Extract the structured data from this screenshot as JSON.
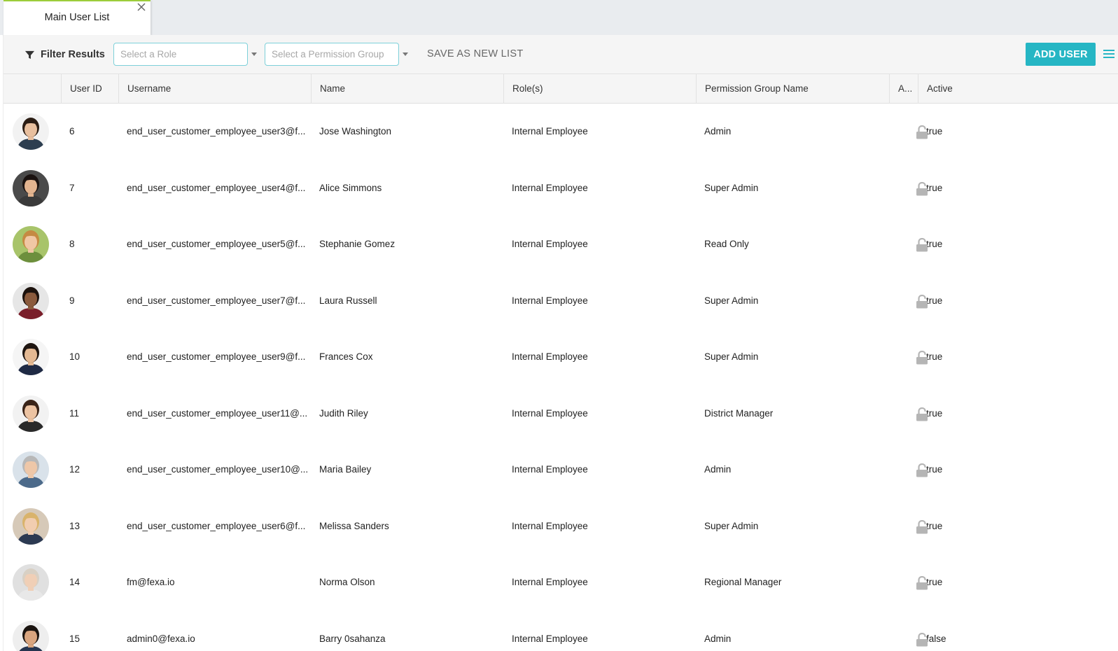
{
  "tabs": [
    {
      "label": "Main User List"
    }
  ],
  "toolbar": {
    "filter_label": "Filter Results",
    "role_placeholder": "Select a Role",
    "permission_placeholder": "Select a Permission Group",
    "save_label": "SAVE AS NEW LIST",
    "add_user_label": "ADD USER"
  },
  "colors": {
    "accent": "#26b6c4",
    "tab_indicator": "#9ccd3a",
    "select_border": "#7dd0d9"
  },
  "columns": [
    "",
    "User ID",
    "Username",
    "Name",
    "Role(s)",
    "Permission Group Name",
    "A...",
    "Active"
  ],
  "rows": [
    {
      "id": "6",
      "username": "end_user_customer_employee_user3@f...",
      "name": "Jose Washington",
      "role": "Internal Employee",
      "group": "Admin",
      "active": "true",
      "avatar": {
        "skin": "#e8bf9e",
        "hair": "#2b1d14",
        "shirt": "#2d3e50",
        "bg": "#f2f2f2"
      }
    },
    {
      "id": "7",
      "username": "end_user_customer_employee_user4@f...",
      "name": "Alice Simmons",
      "role": "Internal Employee",
      "group": "Super Admin",
      "active": "true",
      "avatar": {
        "skin": "#e3b48f",
        "hair": "#1a1210",
        "shirt": "#3a3a3a",
        "bg": "#4a4a4a"
      }
    },
    {
      "id": "8",
      "username": "end_user_customer_employee_user5@f...",
      "name": "Stephanie Gomez",
      "role": "Internal Employee",
      "group": "Read Only",
      "active": "true",
      "avatar": {
        "skin": "#f0c7a4",
        "hair": "#c58a42",
        "shirt": "#6d8f3d",
        "bg": "#a8c46a"
      }
    },
    {
      "id": "9",
      "username": "end_user_customer_employee_user7@f...",
      "name": "Laura Russell",
      "role": "Internal Employee",
      "group": "Super Admin",
      "active": "true",
      "avatar": {
        "skin": "#8a5a3c",
        "hair": "#1c120d",
        "shirt": "#7a1e2a",
        "bg": "#e6e6e6"
      }
    },
    {
      "id": "10",
      "username": "end_user_customer_employee_user9@f...",
      "name": "Frances Cox",
      "role": "Internal Employee",
      "group": "Super Admin",
      "active": "true",
      "avatar": {
        "skin": "#e4b993",
        "hair": "#1e1510",
        "shirt": "#1f2a44",
        "bg": "#f5f5f5"
      }
    },
    {
      "id": "11",
      "username": "end_user_customer_employee_user11@...",
      "name": "Judith Riley",
      "role": "Internal Employee",
      "group": "District Manager",
      "active": "true",
      "avatar": {
        "skin": "#ecc3a2",
        "hair": "#3a2418",
        "shirt": "#2a2a2a",
        "bg": "#f2f2f2"
      }
    },
    {
      "id": "12",
      "username": "end_user_customer_employee_user10@...",
      "name": "Maria Bailey",
      "role": "Internal Employee",
      "group": "Admin",
      "active": "true",
      "avatar": {
        "skin": "#eec7a8",
        "hair": "#b8b8b8",
        "shirt": "#4c6a8a",
        "bg": "#d9e2ea"
      }
    },
    {
      "id": "13",
      "username": "end_user_customer_employee_user6@f...",
      "name": "Melissa Sanders",
      "role": "Internal Employee",
      "group": "Super Admin",
      "active": "true",
      "avatar": {
        "skin": "#f1cdb0",
        "hair": "#d9b36b",
        "shirt": "#2c3a52",
        "bg": "#d6c9b8"
      }
    },
    {
      "id": "14",
      "username": "fm@fexa.io",
      "name": "Norma Olson",
      "role": "Internal Employee",
      "group": "Regional Manager",
      "active": "true",
      "avatar": {
        "skin": "#f0cfb6",
        "hair": "#d8d0c4",
        "shirt": "#e8e8e8",
        "bg": "#e0e0e0"
      }
    },
    {
      "id": "15",
      "username": "admin0@fexa.io",
      "name": "Barry 0sahanza",
      "role": "Internal Employee",
      "group": "Admin",
      "active": "false",
      "avatar": {
        "skin": "#d9a57f",
        "hair": "#1b1410",
        "shirt": "#25344f",
        "bg": "#eeeeee"
      }
    }
  ]
}
